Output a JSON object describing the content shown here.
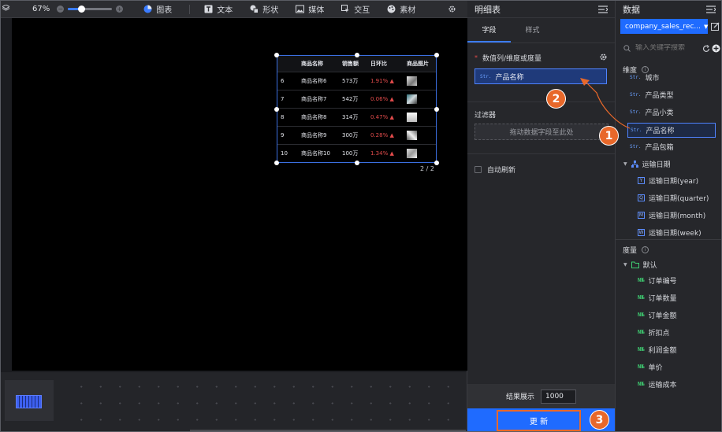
{
  "toolbar": {
    "zoom": "67%",
    "items": [
      "图表",
      "文本",
      "形状",
      "媒体",
      "交互",
      "素材"
    ]
  },
  "table_widget": {
    "headers": [
      "",
      "商品名称",
      "销售额",
      "日环比",
      "商品图片"
    ],
    "rows": [
      {
        "idx": "6",
        "name": "商品名称6",
        "sales": "573万",
        "change": "1.91%"
      },
      {
        "idx": "7",
        "name": "商品名称7",
        "sales": "542万",
        "change": "0.06%"
      },
      {
        "idx": "8",
        "name": "商品名称8",
        "sales": "314万",
        "change": "0.47%"
      },
      {
        "idx": "9",
        "name": "商品名称9",
        "sales": "300万",
        "change": "0.28%"
      },
      {
        "idx": "10",
        "name": "商品名称10",
        "sales": "100万",
        "change": "1.34%"
      }
    ],
    "pager": "2 / 2"
  },
  "detail_panel": {
    "title": "明细表",
    "tabs": [
      "字段",
      "样式"
    ],
    "fields_section": "数值列/维度或度量",
    "field_chip": "产品名称",
    "filter_title": "过滤器",
    "filter_placeholder": "拖动数据字段至此处",
    "auto_refresh": "自动刷新",
    "result_label": "结果展示",
    "result_value": "1000",
    "update_label": "更 新"
  },
  "data_panel": {
    "title": "数据",
    "dataset": "company_sales_rec...",
    "search_placeholder": "输入关键字搜索",
    "dimension_title": "维度",
    "dimensions": [
      "城市",
      "产品类型",
      "产品小类",
      "产品名称",
      "产品包箱"
    ],
    "date_group": "运输日期",
    "date_items": [
      {
        "code": "Y",
        "label": "运输日期(year)"
      },
      {
        "code": "Q",
        "label": "运输日期(quarter)"
      },
      {
        "code": "M",
        "label": "运输日期(month)"
      },
      {
        "code": "W",
        "label": "运输日期(week)"
      }
    ],
    "measure_title": "度量",
    "measure_group": "默认",
    "measures": [
      "订单编号",
      "订单数量",
      "订单金额",
      "折扣点",
      "利润金额",
      "单价",
      "运输成本"
    ]
  },
  "badges": [
    "1",
    "2",
    "3"
  ],
  "colors": {
    "accent": "#1f6bff",
    "badge": "#e8682a",
    "up": "#e24b4b"
  }
}
